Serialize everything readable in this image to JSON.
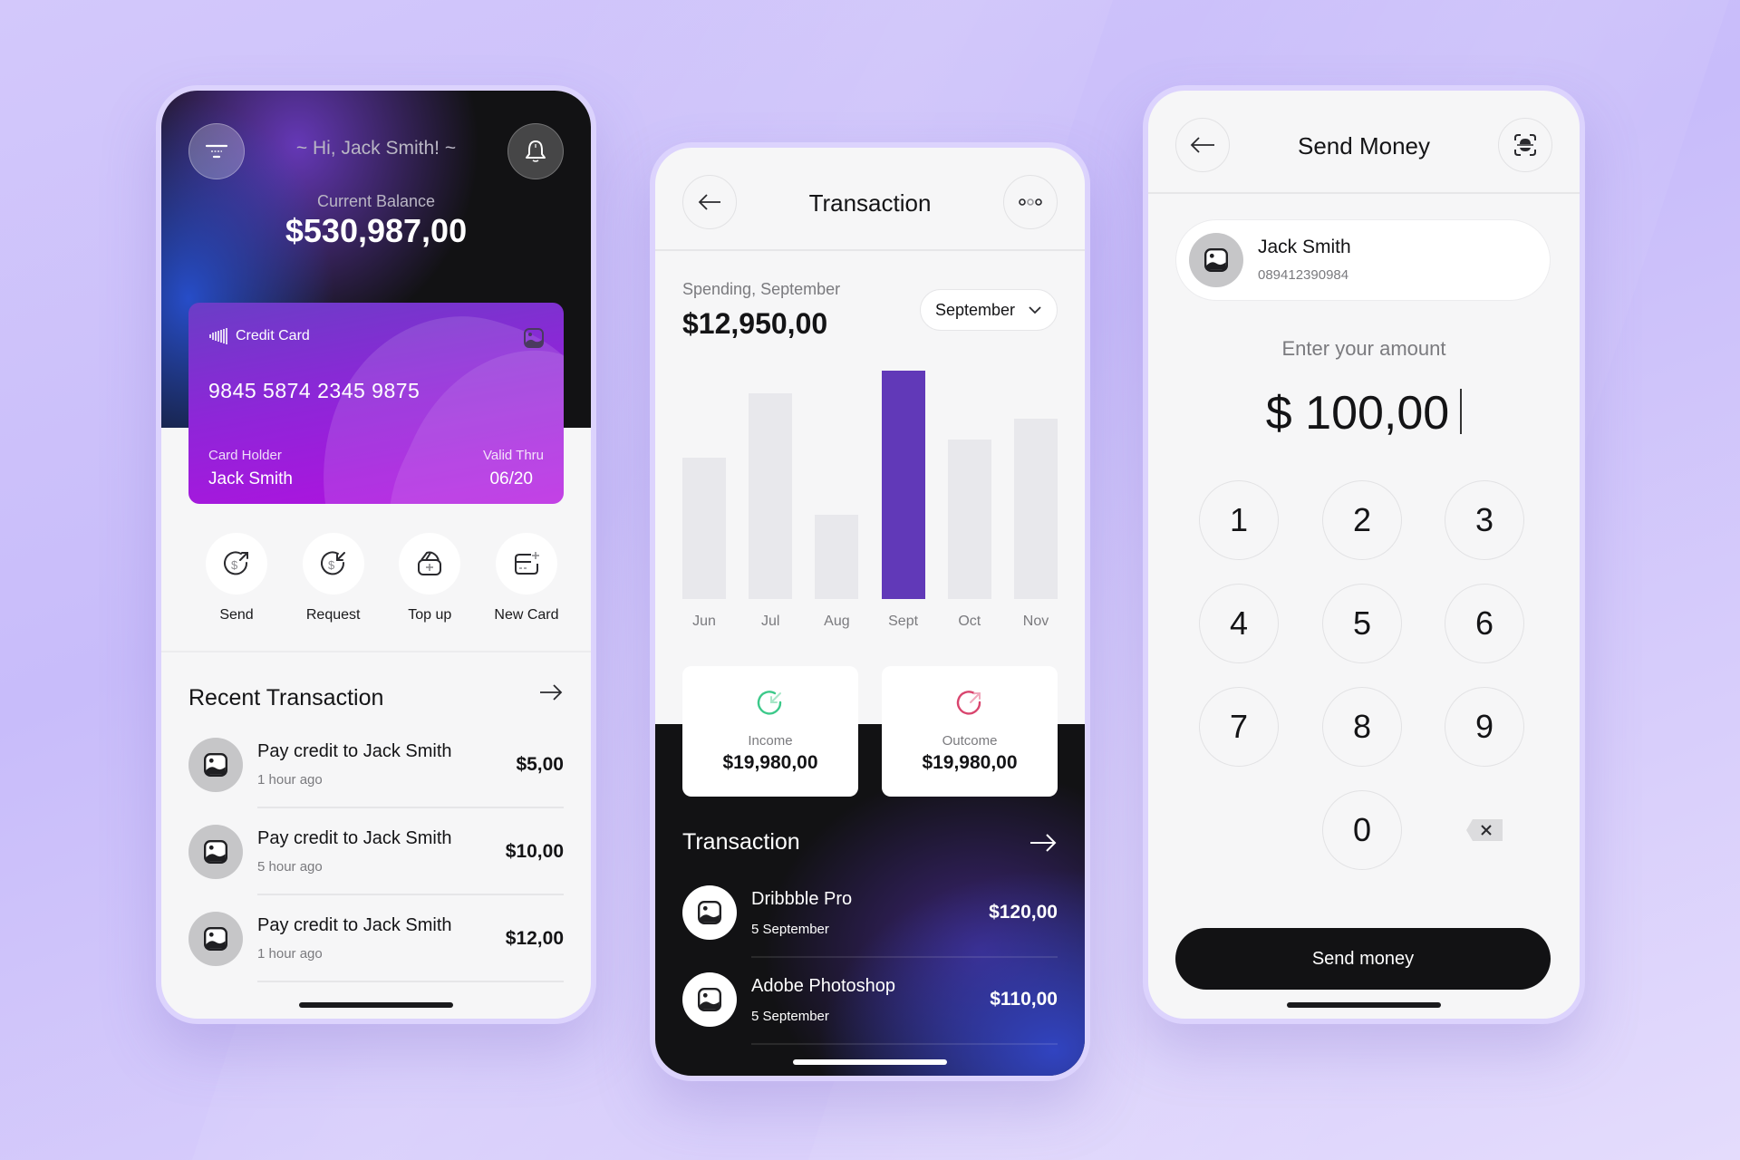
{
  "colors": {
    "accent_purple": "#6139b8",
    "card_gradient_start": "#6a3ec6",
    "card_gradient_end": "#b40fe0",
    "income_green": "#3cc98a",
    "outcome_red": "#d9456e",
    "dark_bg": "#121214"
  },
  "home": {
    "greeting": "~ Hi, Jack Smith! ~",
    "balance_label": "Current Balance",
    "balance_value": "$530,987,00",
    "menu_icon": "filter-menu-icon",
    "notification_icon": "bell-icon",
    "card": {
      "brand_label": "Credit Card",
      "number": "9845 5874 2345 9875",
      "holder_label": "Card Holder",
      "holder_name": "Jack Smith",
      "valid_label": "Valid Thru",
      "valid_value": "06/20"
    },
    "actions": [
      {
        "label": "Send",
        "icon": "dollar-send-icon"
      },
      {
        "label": "Request",
        "icon": "dollar-request-icon"
      },
      {
        "label": "Top up",
        "icon": "wallet-add-icon"
      },
      {
        "label": "New Card",
        "icon": "card-add-icon"
      }
    ],
    "recent_title": "Recent Transaction",
    "recent": [
      {
        "title": "Pay credit to Jack Smith",
        "time": "1 hour ago",
        "amount": "$5,00"
      },
      {
        "title": "Pay credit to Jack Smith",
        "time": "5 hour ago",
        "amount": "$10,00"
      },
      {
        "title": "Pay credit to  Jack Smith",
        "time": "1 hour ago",
        "amount": "$12,00"
      }
    ]
  },
  "transaction": {
    "title": "Transaction",
    "spending_label": "Spending, September",
    "spending_value": "$12,950,00",
    "month_select": "September",
    "income_label": "Income",
    "income_value": "$19,980,00",
    "outcome_label": "Outcome",
    "outcome_value": "$19,980,00",
    "list_title": "Transaction",
    "items": [
      {
        "title": "Dribbble Pro",
        "date": "5 September",
        "amount": "$120,00"
      },
      {
        "title": "Adobe Photoshop",
        "date": "5 September",
        "amount": "$110,00"
      }
    ]
  },
  "chart_data": {
    "type": "bar",
    "title": "",
    "xlabel": "",
    "ylabel": "",
    "categories": [
      "Jun",
      "Jul",
      "Aug",
      "Sept",
      "Oct",
      "Nov"
    ],
    "values": [
      62,
      90,
      37,
      100,
      70,
      79
    ],
    "value_units": "relative (percent of Sept, no axis shown)",
    "highlighted": "Sept",
    "ylim": [
      0,
      100
    ],
    "grid": false
  },
  "send_money": {
    "title": "Send Money",
    "scan_icon": "scan-icon",
    "recipient_name": "Jack Smith",
    "recipient_phone": "089412390984",
    "amount_label": "Enter your amount",
    "amount_value": "$ 100,00",
    "keys": [
      "1",
      "2",
      "3",
      "4",
      "5",
      "6",
      "7",
      "8",
      "9",
      "0"
    ],
    "backspace_icon": "backspace-icon",
    "send_button": "Send money"
  }
}
